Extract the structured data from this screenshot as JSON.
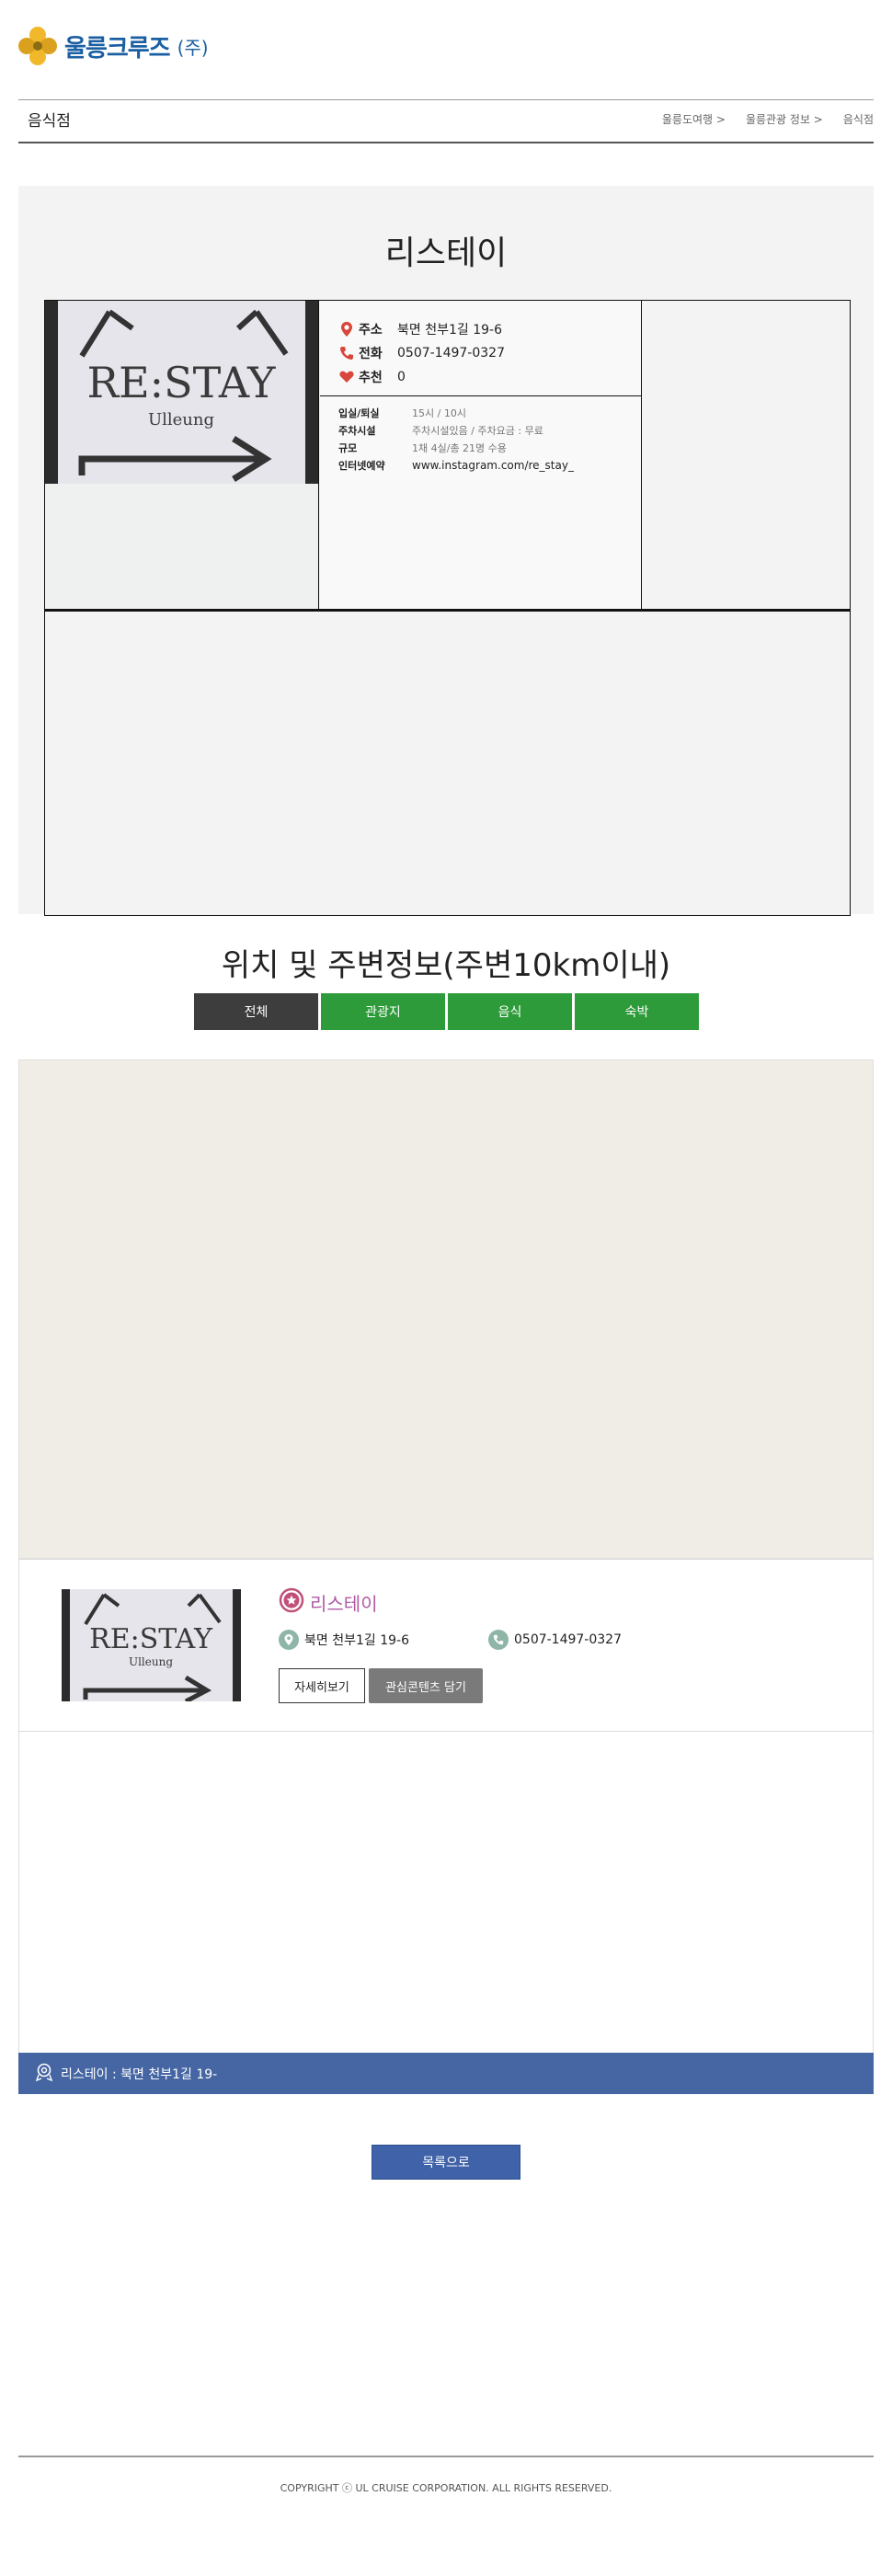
{
  "header": {
    "logo_text": "울릉크루즈",
    "logo_suffix": "(주)"
  },
  "category_bar": {
    "title": "음식점",
    "breadcrumbs": [
      "울릉도여행 >",
      "울릉관광 정보 >",
      "음식점"
    ]
  },
  "detail": {
    "title": "리스테이",
    "photo_sign_text": "RE:STAY",
    "photo_sign_sub": "Ulleung",
    "info": [
      {
        "icon": "pin-icon",
        "label": "주소",
        "value": "북면 천부1길 19-6"
      },
      {
        "icon": "phone-icon",
        "label": "전화",
        "value": "0507-1497-0327"
      },
      {
        "icon": "heart-icon",
        "label": "추천",
        "value": "0"
      }
    ],
    "details": [
      {
        "key": "입실/퇴실",
        "value": "15시 / 10시"
      },
      {
        "key": "주차시설",
        "value": "주차시설있음 / 주차요금 : 무료"
      },
      {
        "key": "규모",
        "value": "1채 4실/총 21명 수용"
      },
      {
        "key": "인터넷예약",
        "value": "www.instagram.com/re_stay_"
      }
    ]
  },
  "location": {
    "title": "위치 및 주변정보(주변10km이내)",
    "tabs": [
      "전체",
      "관광지",
      "음식",
      "숙박"
    ],
    "active_tab": "전체"
  },
  "card": {
    "name": "리스테이",
    "address": "북면 천부1길 19-6",
    "phone": "0507-1497-0327",
    "detail_button": "자세히보기",
    "like_button": "관심콘텐츠 담기"
  },
  "address_bar": {
    "text": "리스테이 : 북면 천부1길 19-"
  },
  "back_button": "목록으로",
  "footer": {
    "copyright": "COPYRIGHT ⓒ UL CRUISE CORPORATION. ALL RIGHTS RESERVED."
  },
  "colors": {
    "logo_blue": "#1b5fa3",
    "tab_green": "#2e9b3a",
    "tab_active": "#3d3d3d",
    "address_bar_blue": "#4566a3",
    "card_name_purple": "#b05aa6"
  }
}
